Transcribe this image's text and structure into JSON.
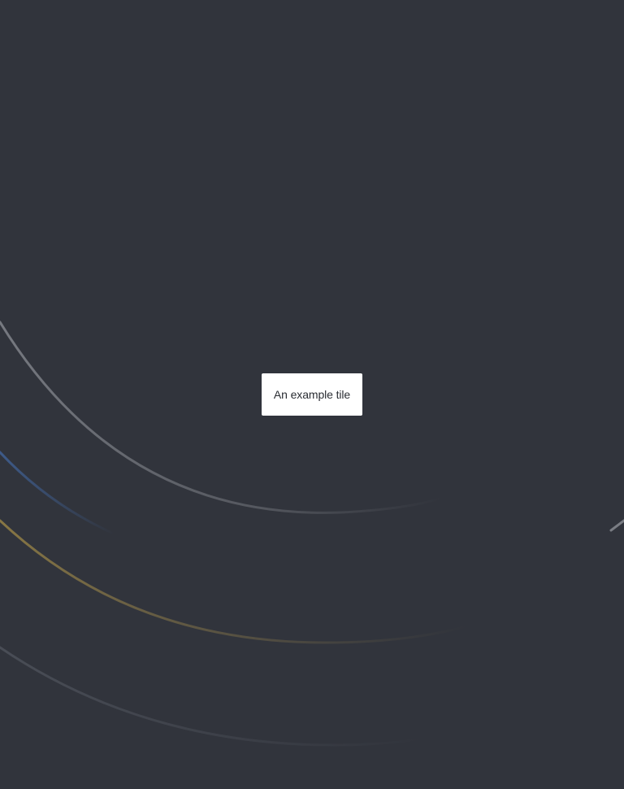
{
  "tile": {
    "label": "An example tile"
  },
  "colors": {
    "background": "#31343c",
    "tile_background": "#ffffff",
    "tile_text": "#2a2d33",
    "arc_grey": "#8a8d93",
    "arc_blue": "#3b5a8c",
    "arc_gold": "#8a7a4a"
  }
}
